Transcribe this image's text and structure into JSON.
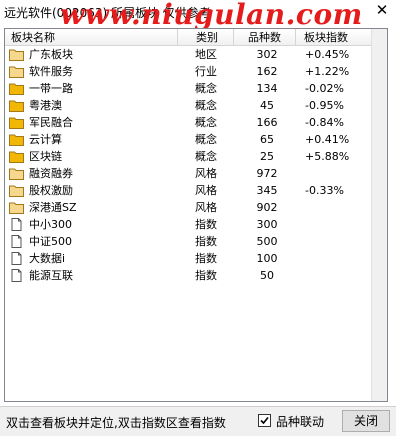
{
  "window": {
    "title": "远光软件(002063) 所属板块 仅供参考",
    "watermark": "www.niugulan.com",
    "close_glyph": "✕"
  },
  "table": {
    "columns": [
      "板块名称",
      "类别",
      "品种数",
      "板块指数"
    ],
    "rows": [
      {
        "icon": "folder-icon",
        "name": "广东板块",
        "category": "地区",
        "count": "302",
        "index": "+0.45%"
      },
      {
        "icon": "folder-icon",
        "name": "软件服务",
        "category": "行业",
        "count": "162",
        "index": "+1.22%"
      },
      {
        "icon": "folder-filled-icon",
        "name": "一带一路",
        "category": "概念",
        "count": "134",
        "index": "-0.02%"
      },
      {
        "icon": "folder-filled-icon",
        "name": "粤港澳",
        "category": "概念",
        "count": "45",
        "index": "-0.95%"
      },
      {
        "icon": "folder-filled-icon",
        "name": "军民融合",
        "category": "概念",
        "count": "166",
        "index": "-0.84%"
      },
      {
        "icon": "folder-filled-icon",
        "name": "云计算",
        "category": "概念",
        "count": "65",
        "index": "+0.41%"
      },
      {
        "icon": "folder-filled-icon",
        "name": "区块链",
        "category": "概念",
        "count": "25",
        "index": "+5.88%"
      },
      {
        "icon": "folder-icon",
        "name": "融资融券",
        "category": "风格",
        "count": "972",
        "index": ""
      },
      {
        "icon": "folder-icon",
        "name": "股权激励",
        "category": "风格",
        "count": "345",
        "index": "-0.33%"
      },
      {
        "icon": "folder-icon",
        "name": "深港通SZ",
        "category": "风格",
        "count": "902",
        "index": ""
      },
      {
        "icon": "document-icon",
        "name": "中小300",
        "category": "指数",
        "count": "300",
        "index": ""
      },
      {
        "icon": "document-icon",
        "name": "中证500",
        "category": "指数",
        "count": "500",
        "index": ""
      },
      {
        "icon": "document-icon",
        "name": "大数据i",
        "category": "指数",
        "count": "100",
        "index": ""
      },
      {
        "icon": "document-icon",
        "name": "能源互联",
        "category": "指数",
        "count": "50",
        "index": ""
      }
    ]
  },
  "status": {
    "hint": "双击查看板块并定位,双击指数区查看指数",
    "linkage_label": "品种联动",
    "linkage_checked": true,
    "close_label": "关闭"
  },
  "colors": {
    "folder_fill": "#f5d78e",
    "folder_filled": "#f2b705",
    "watermark": "#e51c1c"
  }
}
